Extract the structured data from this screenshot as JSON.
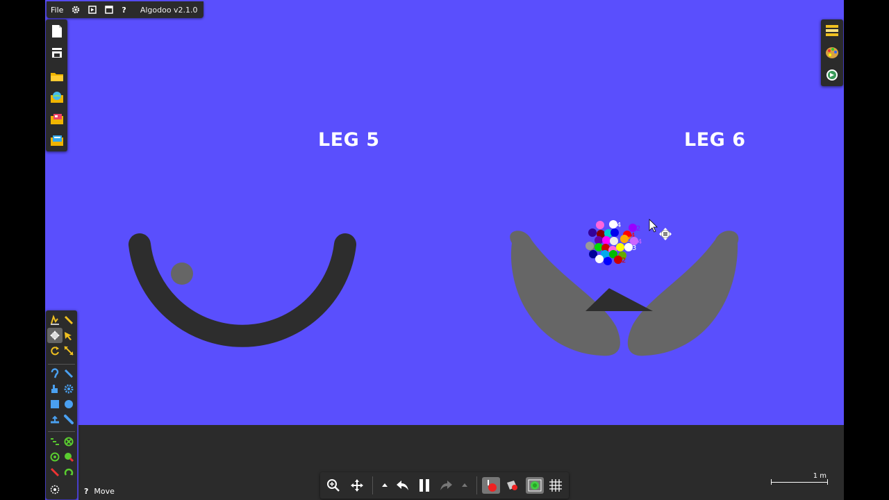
{
  "app": {
    "version": "Algodoo v2.1.0"
  },
  "menu": {
    "file_label": "File",
    "help_label": "?"
  },
  "scene": {
    "labels": [
      "LEG 5",
      "LEG 6"
    ],
    "colors": {
      "background": "#5a4ffd",
      "ground": "#2b2b2b",
      "bowl": "#2d2d2d",
      "flipper": "#666666",
      "wedge": "#2d2d2d",
      "ball": "#666666"
    },
    "balls": [
      {
        "color": "#ff66dd"
      },
      {
        "color": "#ffffff",
        "label": "4"
      },
      {
        "color": "#9900ff",
        "label": "2"
      },
      {
        "color": "#330099"
      },
      {
        "color": "#880000"
      },
      {
        "color": "#00cccc"
      },
      {
        "color": "#0000ee"
      },
      {
        "color": "#ff0000",
        "label": "4"
      },
      {
        "color": "#777777"
      },
      {
        "color": "#6600aa"
      },
      {
        "color": "#ff00ff"
      },
      {
        "color": "#eeeeee"
      },
      {
        "color": "#ffaa00",
        "label": "5"
      },
      {
        "color": "#cc66ff",
        "label": "4"
      },
      {
        "color": "#999999"
      },
      {
        "color": "#00dd00"
      },
      {
        "color": "#cc0000"
      },
      {
        "color": "#ff66dd"
      },
      {
        "color": "#ffff00"
      },
      {
        "color": "#ffffff",
        "label": "3"
      },
      {
        "color": "#000099"
      },
      {
        "color": "#00aaee",
        "label": "5"
      },
      {
        "color": "#00bb00"
      },
      {
        "color": "#66aa00"
      },
      {
        "color": "#ffffff"
      },
      {
        "color": "#0000ff"
      },
      {
        "color": "#cc0000",
        "label": "2"
      }
    ]
  },
  "tooltip": {
    "icon": "?",
    "text": "Move"
  },
  "scale": {
    "text": "1 m"
  }
}
